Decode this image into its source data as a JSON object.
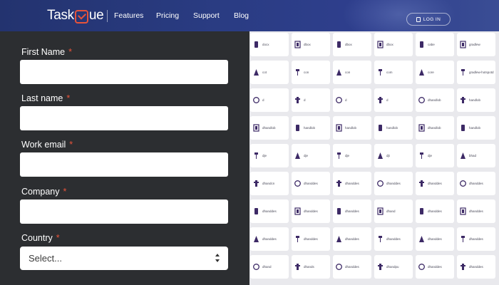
{
  "header": {
    "logo_prefix": "Task",
    "logo_suffix": "ue",
    "nav": [
      "Features",
      "Pricing",
      "Support",
      "Blog"
    ],
    "login_label": "LOG IN"
  },
  "form": {
    "fields": [
      {
        "label": "First Name",
        "required": "*",
        "value": ""
      },
      {
        "label": "Last name",
        "required": "*",
        "value": ""
      },
      {
        "label": "Work email",
        "required": "*",
        "value": ""
      },
      {
        "label": "Company",
        "required": "*",
        "value": ""
      }
    ],
    "country": {
      "label": "Country",
      "required": "*",
      "selected": "Select..."
    }
  },
  "grid": {
    "icon_color": "#3d2a66",
    "rows": [
      [
        "docx",
        "dbox",
        "dbox",
        "dbox",
        "cabe",
        "gradlew"
      ],
      [
        "cot",
        "con",
        "con",
        "com",
        "core",
        "gradlew-hotspotd"
      ],
      [
        "d",
        "d",
        "d",
        "d",
        "dhandlob",
        "handlob"
      ],
      [
        "dhandlob",
        "handlob",
        "handlob",
        "handlob",
        "dhandlob",
        "handlob"
      ],
      [
        "dje",
        "dje",
        "dje",
        "djt",
        "dje",
        "bhad"
      ],
      [
        "dhandcn",
        "dhanddes",
        "dhanddes",
        "dhanddes",
        "dhanddes",
        "dhanddes"
      ],
      [
        "dhanddes",
        "dhanddes",
        "dhanddes",
        "dhand",
        "dhanddes",
        "dhanddes"
      ],
      [
        "dhanddes",
        "dhanddes",
        "dhanddes",
        "dhanddes",
        "dhanddes",
        "dhanddes"
      ],
      [
        "dhand",
        "dhands",
        "dhanddes",
        "dhandpu",
        "dhanddes",
        "dhanddes"
      ]
    ]
  }
}
